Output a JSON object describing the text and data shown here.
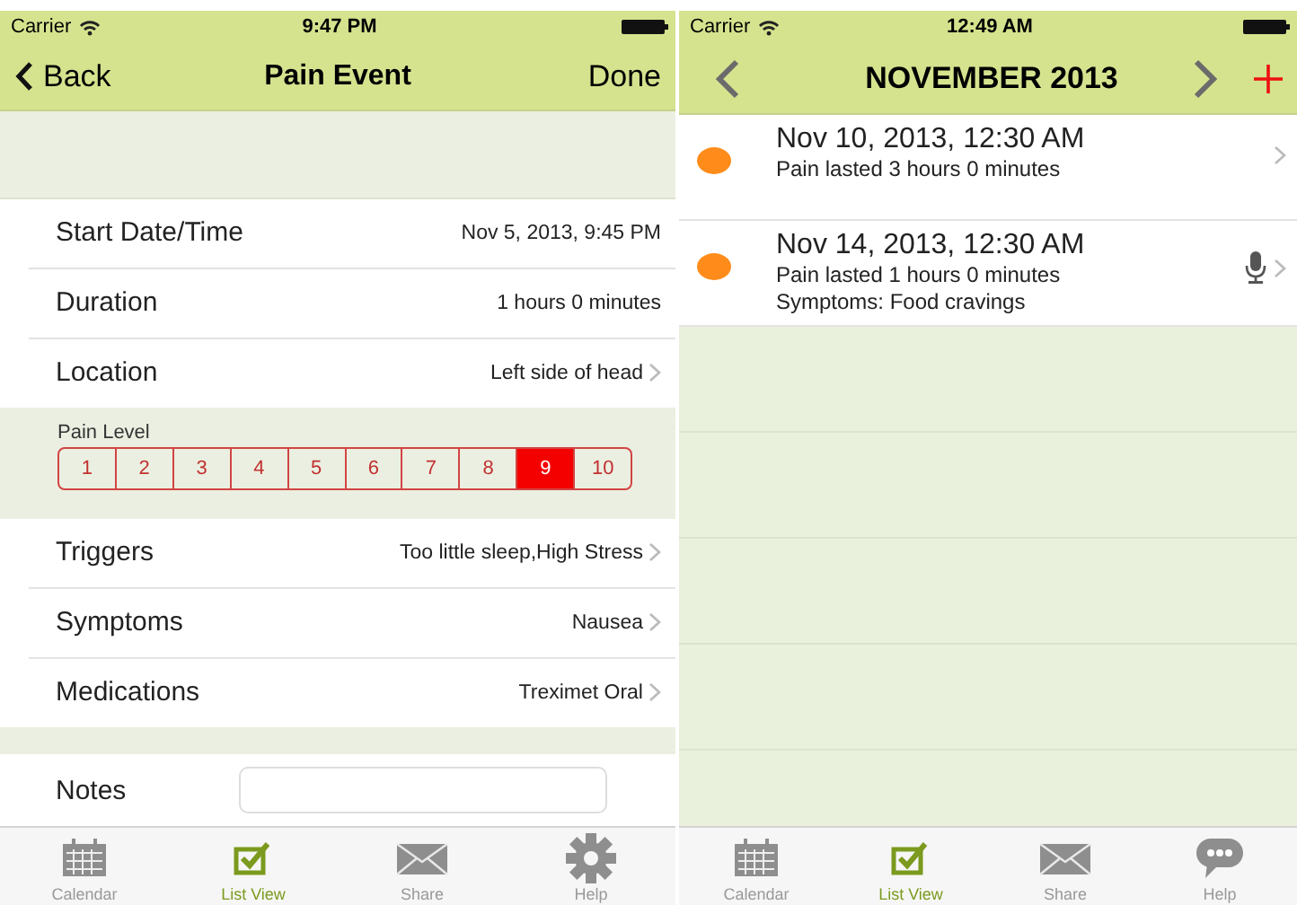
{
  "event_screen": {
    "status_bar": {
      "carrier": "Carrier",
      "time": "9:47 PM"
    },
    "nav": {
      "back": "Back",
      "title": "Pain Event",
      "done": "Done"
    },
    "rows_top": [
      {
        "label": "Start Date/Time",
        "value": "Nov 5, 2013, 9:45 PM",
        "disclosure": false
      },
      {
        "label": "Duration",
        "value": "1 hours 0 minutes",
        "disclosure": false
      },
      {
        "label": "Location",
        "value": "Left side of head",
        "disclosure": true
      }
    ],
    "pain_level": {
      "label": "Pain Level",
      "options": [
        {
          "label": "1",
          "selected": false
        },
        {
          "label": "2",
          "selected": false
        },
        {
          "label": "3",
          "selected": false
        },
        {
          "label": "4",
          "selected": false
        },
        {
          "label": "5",
          "selected": false
        },
        {
          "label": "6",
          "selected": false
        },
        {
          "label": "7",
          "selected": false
        },
        {
          "label": "8",
          "selected": false
        },
        {
          "label": "9",
          "selected": true
        },
        {
          "label": "10",
          "selected": false
        }
      ]
    },
    "rows_bottom": [
      {
        "label": "Triggers",
        "value": "Too little sleep,High Stress",
        "disclosure": true
      },
      {
        "label": "Symptoms",
        "value": "Nausea",
        "disclosure": true
      },
      {
        "label": "Medications",
        "value": "Treximet Oral",
        "disclosure": true
      }
    ],
    "notes": {
      "label": "Notes"
    },
    "tabs": [
      {
        "label": "Calendar",
        "selected": false
      },
      {
        "label": "List View",
        "selected": true
      },
      {
        "label": "Share",
        "selected": false
      },
      {
        "label": "Help",
        "selected": false
      }
    ]
  },
  "list_screen": {
    "status_bar": {
      "carrier": "Carrier",
      "time": "12:49 AM"
    },
    "nav": {
      "title": "NOVEMBER 2013"
    },
    "events": [
      {
        "title": "Nov 10, 2013, 12:30 AM",
        "details": [
          "Pain lasted 3 hours 0 minutes"
        ],
        "color": "#ff8c1a",
        "audio": false
      },
      {
        "title": "Nov 14, 2013, 12:30 AM",
        "details": [
          "Pain lasted 1 hours 0 minutes",
          "Symptoms: Food cravings"
        ],
        "color": "#ff8c1a",
        "audio": true
      }
    ],
    "tabs": [
      {
        "label": "Calendar",
        "selected": false
      },
      {
        "label": "List View",
        "selected": true
      },
      {
        "label": "Share",
        "selected": false
      },
      {
        "label": "Help",
        "selected": false
      }
    ]
  }
}
